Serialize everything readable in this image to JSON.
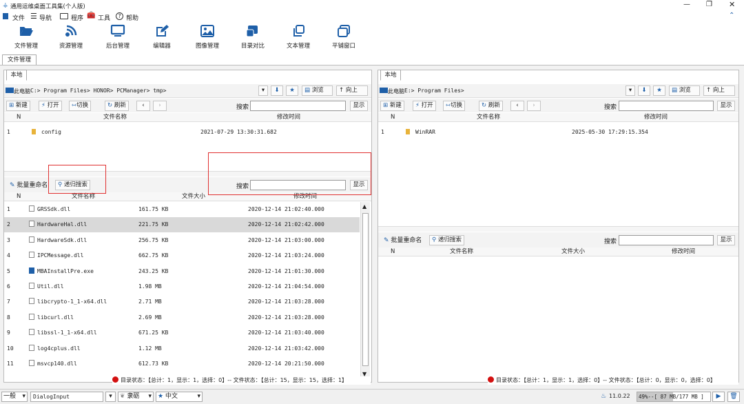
{
  "app": {
    "title": "通用运维桌面工具集(个人版)"
  },
  "menu": {
    "file": "文件",
    "nav": "导航",
    "program": "程序",
    "tools": "工具",
    "help": "帮助"
  },
  "toolbar": [
    {
      "label": "文件管理",
      "icon": "folder-open-icon"
    },
    {
      "label": "资源管理",
      "icon": "wifi-icon"
    },
    {
      "label": "后台管理",
      "icon": "monitor-icon"
    },
    {
      "label": "编辑器",
      "icon": "edit-icon"
    },
    {
      "label": "图像管理",
      "icon": "image-icon"
    },
    {
      "label": "目录对比",
      "icon": "compare-icon"
    },
    {
      "label": "文本管理",
      "icon": "copy-icon"
    },
    {
      "label": "平铺窗口",
      "icon": "window-icon"
    }
  ],
  "page_tab": "文件管理",
  "left": {
    "tab": "本地",
    "path_root": "此电脑",
    "path": "C:> Program Files> HONOR> PCManager> tmp>",
    "browse": "浏览",
    "up": "向上",
    "new": "新建",
    "open": "打开",
    "switch": "切换",
    "refresh": "刷新",
    "search_label": "搜索",
    "show": "显示",
    "col_n": "N",
    "col_name": "文件名称",
    "col_time": "修改时间",
    "dirs": [
      {
        "n": "1",
        "name": "config",
        "time": "2021-07-29 13:30:31.682"
      }
    ],
    "batch_rename": "批量重命名",
    "recursive": "递归搜索",
    "search2": "搜索",
    "show2": "显示",
    "col2_n": "N",
    "col2_name": "文件名称",
    "col2_size": "文件大小",
    "col2_time": "修改时间",
    "files": [
      {
        "n": "1",
        "name": "GRSSdk.dll",
        "size": "161.75 KB",
        "time": "2020-12-14 21:02:40.000"
      },
      {
        "n": "2",
        "name": "HardwareHal.dll",
        "size": "221.75 KB",
        "time": "2020-12-14 21:02:42.000"
      },
      {
        "n": "3",
        "name": "HardwareSdk.dll",
        "size": "256.75 KB",
        "time": "2020-12-14 21:03:00.000"
      },
      {
        "n": "4",
        "name": "IPCMessage.dll",
        "size": "662.75 KB",
        "time": "2020-12-14 21:03:24.000"
      },
      {
        "n": "5",
        "name": "MBAInstallPre.exe",
        "size": "243.25 KB",
        "time": "2020-12-14 21:01:30.000"
      },
      {
        "n": "6",
        "name": "Util.dll",
        "size": "1.98 MB",
        "time": "2020-12-14 21:04:54.000"
      },
      {
        "n": "7",
        "name": "libcrypto-1_1-x64.dll",
        "size": "2.71 MB",
        "time": "2020-12-14 21:03:28.000"
      },
      {
        "n": "8",
        "name": "libcurl.dll",
        "size": "2.69 MB",
        "time": "2020-12-14 21:03:28.000"
      },
      {
        "n": "9",
        "name": "libssl-1_1-x64.dll",
        "size": "671.25 KB",
        "time": "2020-12-14 21:03:40.000"
      },
      {
        "n": "10",
        "name": "log4cplus.dll",
        "size": "1.12 MB",
        "time": "2020-12-14 21:03:42.000"
      },
      {
        "n": "11",
        "name": "msvcp140.dll",
        "size": "612.73 KB",
        "time": "2020-12-14 20:21:50.000"
      }
    ],
    "status": "目录状态：【总计：1，显示：1，选择：0】-- 文件状态：【总计：15，显示：15，选择：1】"
  },
  "right": {
    "tab": "本地",
    "path_root": "此电脑",
    "path": "E:> Program Files>",
    "browse": "浏览",
    "up": "向上",
    "new": "新建",
    "open": "打开",
    "switch": "切换",
    "refresh": "刷新",
    "search_label": "搜索",
    "show": "显示",
    "col_n": "N",
    "col_name": "文件名称",
    "col_time": "修改时间",
    "dirs": [
      {
        "n": "1",
        "name": "WinRAR",
        "time": "2025-05-30 17:29:15.354"
      }
    ],
    "batch_rename": "批量重命名",
    "recursive": "递归搜索",
    "search2": "搜索",
    "show2": "显示",
    "col2_n": "N",
    "col2_name": "文件名称",
    "col2_size": "文件大小",
    "col2_time": "修改时间",
    "status": "目录状态：【总计：1，显示：1，选择：0】-- 文件状态：【总计：0，显示：0，选择：0】"
  },
  "statusbar": {
    "mode": "一般",
    "input": "DialogInput",
    "font": "隶砺",
    "lang": "中文",
    "version": "11.0.22",
    "mem_pct": "49%--[",
    "mem": "87 MB/177 MB ]",
    "mem_fill": 0.49
  },
  "colors": {
    "accent": "#1e5fa8",
    "red": "#e03030",
    "selected": "#d9d9d9"
  }
}
